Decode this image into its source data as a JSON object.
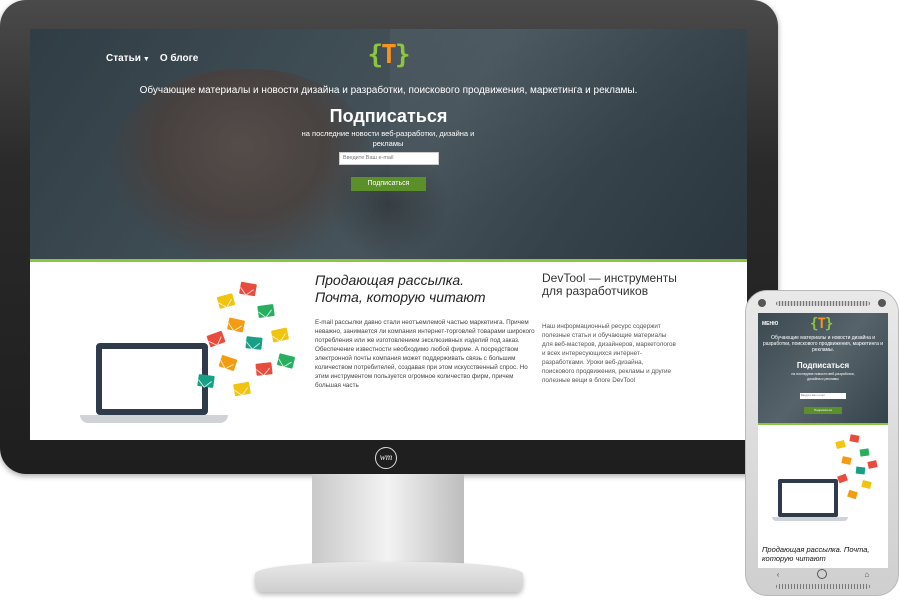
{
  "desktop": {
    "nav": {
      "items": [
        {
          "label": "Статьи",
          "dropdown": true
        },
        {
          "label": "О блоге",
          "dropdown": false
        }
      ]
    },
    "logo": {
      "left": "{",
      "mark": "T",
      "right": "}"
    },
    "tagline": "Обучающие материалы и новости дизайна и разработки, поискового продвижения, маркетинга и рекламы.",
    "subscribe": {
      "title": "Подписаться",
      "description": "на последние новости веб-разработки, дизайна и рекламы",
      "email_placeholder": "Введите Ваш e-mail",
      "button_label": "Подписаться"
    },
    "article": {
      "title": "Продающая рассылка. Почта, которую читают",
      "body": "E-mail рассылки давно стали неотъемлемой частью маркетинга. Причем неважно, занимается ли компания интернет-торговлей товарами широкого потребления или же изготовлением эксклюзивных изделий под заказ. Обеспечение известности необходимо любой фирме. А посредством электронной почты компания может поддерживать связь с большим количеством потребителей, создавая при этом искусственный спрос. Но этим инструментом пользуется огромное количество фирм, причем большая часть"
    },
    "sidebar": {
      "title": "DevTool — инструменты для разработчиков",
      "body": "Наш информационный ресурс содержит полезные статьи и обучающие материалы для веб-мастеров, дизайнеров, маркетологов и всех интересующихся интернет-разработками. Уроки веб-дизайна, поискового продвижения, рекламы и другие полезные вещи в блоге DevTool"
    },
    "brand_mark": "wm"
  },
  "mobile": {
    "menu_label": "МЕНЮ",
    "tagline": "Обучающие материалы и новости дизайна и разработки, поискового продвижения, маркетинга и рекламы.",
    "subscribe": {
      "title": "Подписаться",
      "description": "на последние новости веб-разработки, дизайна и рекламы",
      "email_placeholder": "Введите ваш e-mail",
      "button_label": "Подписаться"
    },
    "article_title": "Продающая рассылка. Почта, которую читают",
    "nav_icons": [
      "back-icon",
      "home-icon",
      "recent-apps-icon"
    ]
  },
  "colors": {
    "accent_green": "#8cc63f",
    "button_green": "#5a8f2a",
    "logo_orange": "#f7941d",
    "envelope_red": "#e84c3d",
    "envelope_orange": "#f39c12",
    "envelope_yellow": "#f1c40f",
    "envelope_green": "#27ae60",
    "envelope_teal": "#16a085"
  }
}
